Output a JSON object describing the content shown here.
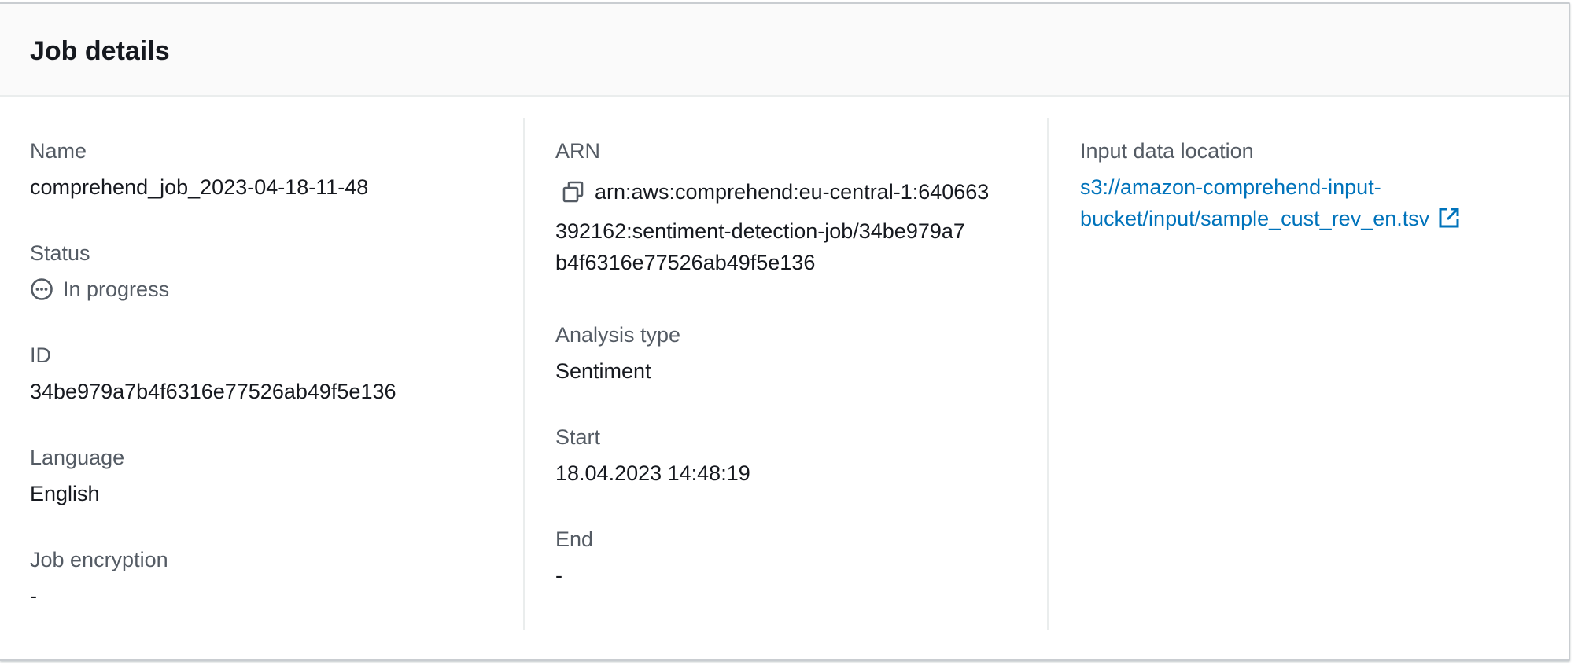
{
  "panel": {
    "title": "Job details"
  },
  "col1": {
    "name_label": "Name",
    "name_value": "comprehend_job_2023-04-18-11-48",
    "status_label": "Status",
    "status_value": "In progress",
    "id_label": "ID",
    "id_value": "34be979a7b4f6316e77526ab49f5e136",
    "language_label": "Language",
    "language_value": "English",
    "encryption_label": "Job encryption",
    "encryption_value": "-"
  },
  "col2": {
    "arn_label": "ARN",
    "arn_line1": "arn:aws:comprehend:eu-central-1:640663",
    "arn_line2": "392162:sentiment-detection-job/34be979a7",
    "arn_line3": "b4f6316e77526ab49f5e136",
    "analysis_label": "Analysis type",
    "analysis_value": "Sentiment",
    "start_label": "Start",
    "start_value": "18.04.2023 14:48:19",
    "end_label": "End",
    "end_value": "-"
  },
  "col3": {
    "input_label": "Input data location",
    "input_line1": "s3://amazon-comprehend-input-",
    "input_line2": "bucket/input/sample_cust_rev_en.tsv"
  },
  "icons": {
    "status": "in-progress-icon",
    "copy": "copy-icon",
    "external": "external-link-icon"
  },
  "colors": {
    "link": "#0073bb",
    "label": "#545b64",
    "text": "#16191f",
    "header_bg": "#fafafa"
  }
}
